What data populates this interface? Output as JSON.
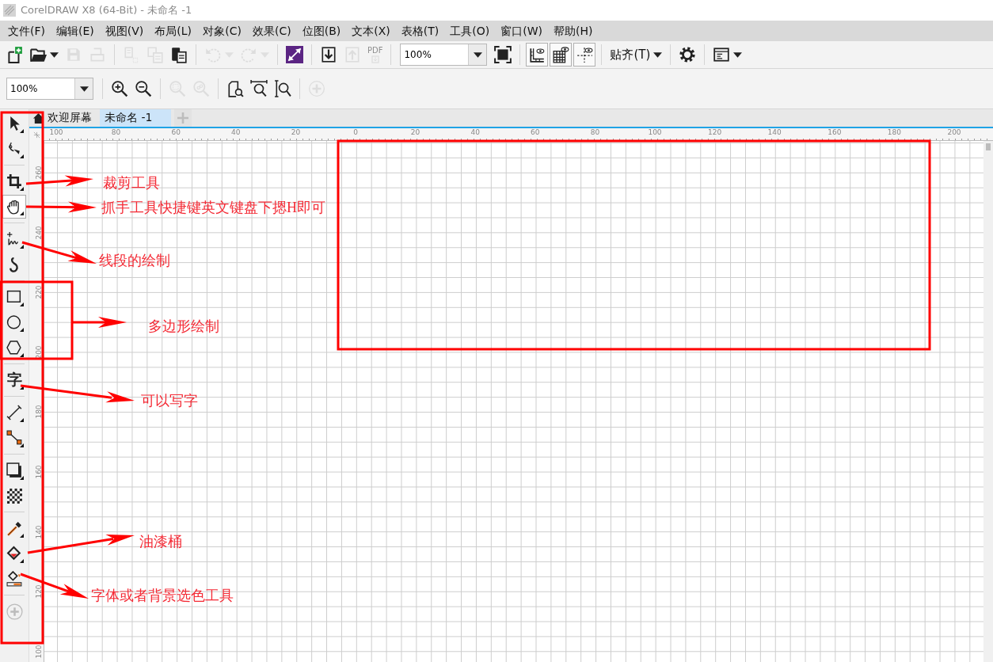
{
  "window": {
    "title": "CorelDRAW X8 (64-Bit) - 未命名 -1"
  },
  "menu": [
    "文件(F)",
    "编辑(E)",
    "视图(V)",
    "布局(L)",
    "对象(C)",
    "效果(C)",
    "位图(B)",
    "文本(X)",
    "表格(T)",
    "工具(O)",
    "窗口(W)",
    "帮助(H)"
  ],
  "toolbar": [
    {
      "kind": "new",
      "disabled": false
    },
    {
      "kind": "open",
      "disabled": false,
      "dropdown": true
    },
    {
      "kind": "save",
      "disabled": true
    },
    {
      "kind": "print",
      "disabled": true
    },
    {
      "kind": "separator"
    },
    {
      "kind": "cut",
      "disabled": true
    },
    {
      "kind": "copy",
      "disabled": true
    },
    {
      "kind": "paste",
      "disabled": false
    },
    {
      "kind": "separator"
    },
    {
      "kind": "undo",
      "disabled": true,
      "dropdown": true
    },
    {
      "kind": "redo",
      "disabled": true,
      "dropdown": true
    },
    {
      "kind": "separator"
    },
    {
      "kind": "connect",
      "disabled": false
    },
    {
      "kind": "separator"
    },
    {
      "kind": "import",
      "disabled": false
    },
    {
      "kind": "export",
      "disabled": true
    },
    {
      "kind": "pdf",
      "disabled": true,
      "label": "PDF"
    },
    {
      "kind": "separator"
    },
    {
      "kind": "zoom_combo",
      "value": "100%"
    },
    {
      "kind": "fullscreen",
      "disabled": false
    },
    {
      "kind": "separator"
    },
    {
      "kind": "rulers",
      "disabled": false,
      "on": true
    },
    {
      "kind": "grid",
      "disabled": false,
      "on": true
    },
    {
      "kind": "guidelines",
      "disabled": false,
      "on": true
    },
    {
      "kind": "separator"
    },
    {
      "kind": "snap",
      "disabled": false,
      "label": "贴齐(T)",
      "dropdown": true
    },
    {
      "kind": "separator"
    },
    {
      "kind": "options",
      "disabled": false
    },
    {
      "kind": "separator"
    },
    {
      "kind": "window",
      "disabled": false,
      "dropdown": true
    }
  ],
  "property_bar": [
    {
      "kind": "zoom_combo",
      "value": "100%"
    },
    {
      "kind": "separator"
    },
    {
      "kind": "zoom_in",
      "disabled": false
    },
    {
      "kind": "zoom_out",
      "disabled": false
    },
    {
      "kind": "separator"
    },
    {
      "kind": "zoom_selected",
      "disabled": true
    },
    {
      "kind": "zoom_all",
      "disabled": true
    },
    {
      "kind": "separator"
    },
    {
      "kind": "zoom_page",
      "disabled": false
    },
    {
      "kind": "zoom_width",
      "disabled": false
    },
    {
      "kind": "zoom_height",
      "disabled": false
    },
    {
      "kind": "separator"
    },
    {
      "kind": "add",
      "disabled": true
    }
  ],
  "tabs": [
    {
      "kind": "welcome",
      "label": "欢迎屏幕",
      "selected": false
    },
    {
      "kind": "document",
      "label": "未命名 -1",
      "selected": true
    }
  ],
  "toolbox": [
    {
      "kind": "select",
      "selected": false,
      "flyout": true
    },
    {
      "kind": "shape",
      "selected": false,
      "flyout": true
    },
    {
      "kind": "separator"
    },
    {
      "kind": "crop",
      "selected": false,
      "flyout": true
    },
    {
      "kind": "pan",
      "selected": true,
      "flyout": true
    },
    {
      "kind": "separator"
    },
    {
      "kind": "freehand",
      "selected": false,
      "flyout": true
    },
    {
      "kind": "artistic",
      "selected": false,
      "flyout": false
    },
    {
      "kind": "separator"
    },
    {
      "kind": "rectangle",
      "selected": false,
      "flyout": true
    },
    {
      "kind": "ellipse",
      "selected": false,
      "flyout": true
    },
    {
      "kind": "polygon",
      "selected": false,
      "flyout": true
    },
    {
      "kind": "separator"
    },
    {
      "kind": "text",
      "label": "字",
      "selected": false,
      "flyout": true
    },
    {
      "kind": "separator"
    },
    {
      "kind": "dimension",
      "selected": false,
      "flyout": true
    },
    {
      "kind": "connector",
      "selected": false,
      "flyout": true
    },
    {
      "kind": "separator"
    },
    {
      "kind": "shadow",
      "selected": false,
      "flyout": true
    },
    {
      "kind": "transparency",
      "selected": false,
      "flyout": false
    },
    {
      "kind": "separator"
    },
    {
      "kind": "eyedropper",
      "selected": false,
      "flyout": true
    },
    {
      "kind": "fill",
      "selected": false,
      "flyout": true
    },
    {
      "kind": "smartfill",
      "selected": false,
      "flyout": false
    },
    {
      "kind": "separator"
    },
    {
      "kind": "add",
      "selected": false,
      "flyout": false
    }
  ],
  "rulers": {
    "horizontal": [
      "100",
      "80",
      "60",
      "40",
      "20",
      "0",
      "20",
      "40",
      "60",
      "80",
      "100",
      "120",
      "140",
      "160",
      "180",
      "200"
    ],
    "vertical": [
      "260",
      "240",
      "220",
      "200",
      "180",
      "160",
      "140",
      "120",
      "100"
    ]
  },
  "annotations": [
    {
      "text": "裁剪工具"
    },
    {
      "text": "抓手工具快捷键英文键盘下摁H即可"
    },
    {
      "text": "线段的绘制"
    },
    {
      "text": "多边形绘制"
    },
    {
      "text": "可以写字"
    },
    {
      "text": "油漆桶"
    },
    {
      "text": "字体或者背景选色工具"
    }
  ]
}
